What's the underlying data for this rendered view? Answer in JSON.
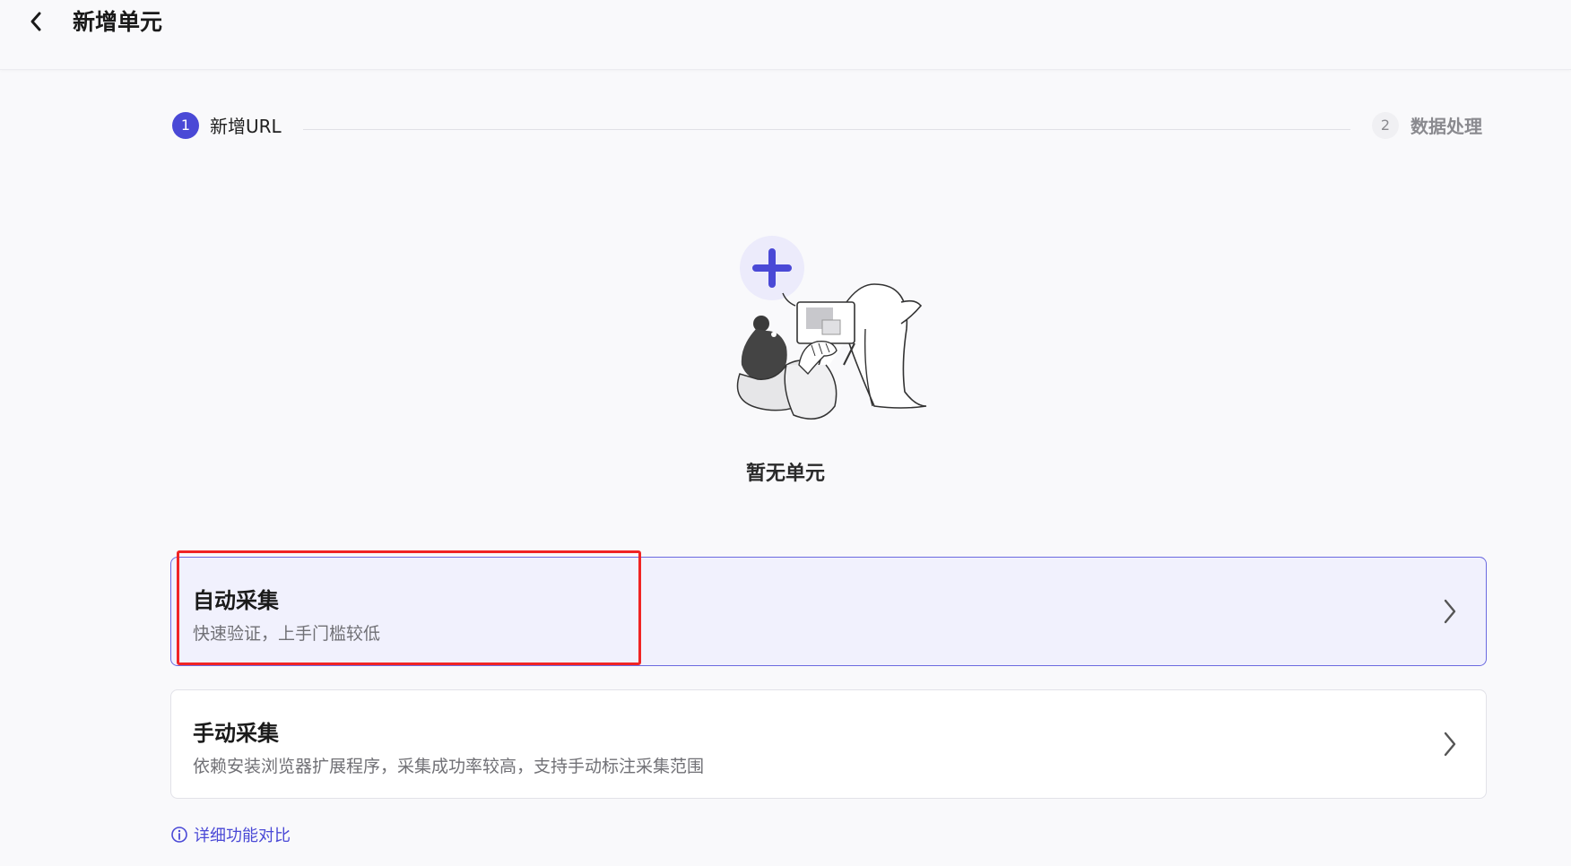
{
  "header": {
    "title": "新增单元",
    "back_icon": "chevron-left-icon"
  },
  "steps": [
    {
      "number": "1",
      "label": "新增URL",
      "state": "active"
    },
    {
      "number": "2",
      "label": "数据处理",
      "state": "pending"
    }
  ],
  "empty_state": {
    "illustration": "person-with-laptop-add-illustration",
    "text": "暂无单元"
  },
  "options": [
    {
      "title": "自动采集",
      "description": "快速验证，上手门槛较低",
      "selected": true
    },
    {
      "title": "手动采集",
      "description": "依赖安装浏览器扩展程序，采集成功率较高，支持手动标注采集范围",
      "selected": false
    }
  ],
  "compare_link": {
    "label": "详细功能对比",
    "icon": "info-circle-icon"
  },
  "colors": {
    "accent": "#4a49d6",
    "selected_card_bg": "#f1f1fd",
    "highlight_outline": "#f02424",
    "background": "#f9f9fb"
  }
}
